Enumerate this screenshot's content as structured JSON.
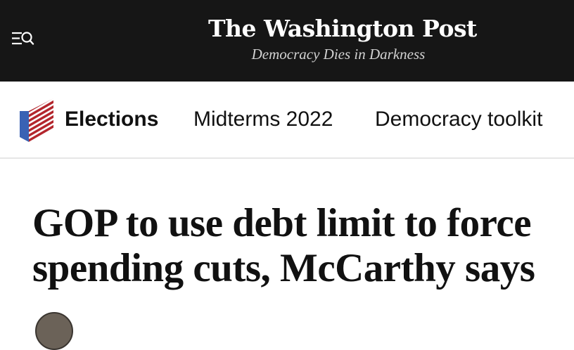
{
  "header": {
    "logo_text": "The Washington Post",
    "tagline": "Democracy Dies in Darkness",
    "menu_icon": "menu-search-icon",
    "background_color": "#161616"
  },
  "nav": {
    "section_icon": "elections-flag-icon",
    "items": [
      {
        "label": "Elections"
      },
      {
        "label": "Midterms 2022"
      },
      {
        "label": "Democracy toolkit"
      }
    ],
    "flag_colors": {
      "blue": "#3a62b4",
      "red": "#b3262d"
    }
  },
  "article": {
    "headline": "GOP to use debt limit to force spending cuts, McCarthy says",
    "byline_avatar": "author-avatar"
  }
}
